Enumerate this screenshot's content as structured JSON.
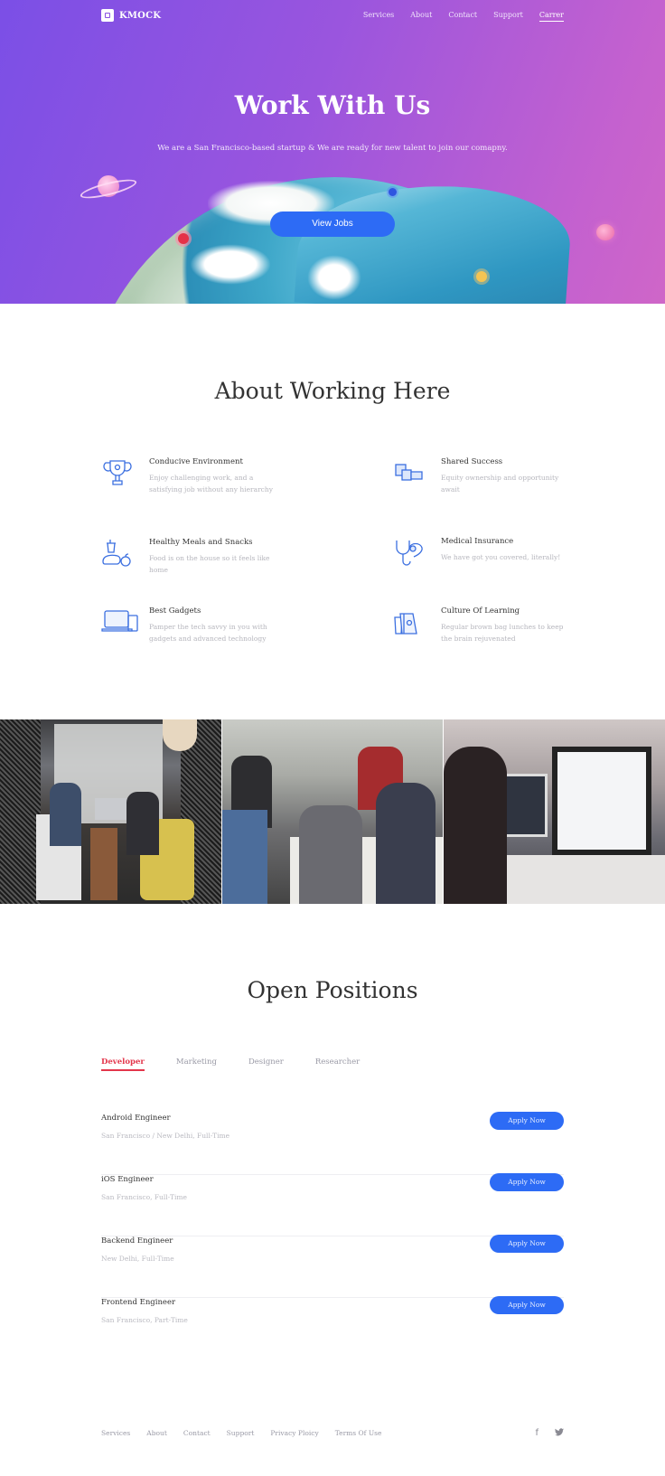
{
  "nav": {
    "brand": "KMOCK",
    "links": [
      {
        "label": "Services"
      },
      {
        "label": "About"
      },
      {
        "label": "Contact"
      },
      {
        "label": "Support"
      },
      {
        "label": "Carrer",
        "active": true
      }
    ]
  },
  "hero": {
    "title": "Work With Us",
    "subtitle": "We are a San Francisco-based startup & We are ready for new talent to join our comapny.",
    "cta_label": "View Jobs"
  },
  "about": {
    "title": "About Working Here",
    "features": [
      {
        "icon": "trophy-icon",
        "title": "Conducive Environment",
        "desc": "Enjoy challenging work, and a satisfying job without any hierarchy"
      },
      {
        "icon": "blocks-icon",
        "title": "Shared Success",
        "desc": "Equity ownership and opportunity await"
      },
      {
        "icon": "meal-icon",
        "title": "Healthy Meals and Snacks",
        "desc": "Food is on the house so it feels like home"
      },
      {
        "icon": "stethoscope-icon",
        "title": "Medical Insurance",
        "desc": "We have got you covered, literally!"
      },
      {
        "icon": "devices-icon",
        "title": "Best Gadgets",
        "desc": "Pamper the tech savvy in you with gadgets and advanced technology"
      },
      {
        "icon": "lunch-bag-icon",
        "title": "Culture Of Learning",
        "desc": "Regular brown bag lunches to keep the brain rejuvenated"
      }
    ]
  },
  "positions": {
    "title": "Open Positions",
    "tabs": [
      {
        "label": "Developer",
        "active": true
      },
      {
        "label": "Marketing"
      },
      {
        "label": "Designer"
      },
      {
        "label": "Researcher"
      }
    ],
    "jobs": [
      {
        "title": "Android Engineer",
        "meta": "San Francisco / New Delhi, Full-Time",
        "apply_label": "Apply  Now"
      },
      {
        "title": "iOS Engineer",
        "meta": "San Francisco, Full-Time",
        "apply_label": "Apply  Now"
      },
      {
        "title": "Backend Engineer",
        "meta": "New Delhi, Full-Time",
        "apply_label": "Apply  Now"
      },
      {
        "title": "Frontend Engineer",
        "meta": "San Francisco, Part-Time",
        "apply_label": "Apply  Now"
      }
    ]
  },
  "footer": {
    "links": [
      {
        "label": "Services"
      },
      {
        "label": "About"
      },
      {
        "label": "Contact"
      },
      {
        "label": "Support"
      },
      {
        "label": "Privacy Ploicy"
      },
      {
        "label": "Terms Of Use"
      }
    ],
    "social": [
      {
        "icon": "facebook-icon",
        "glyph": "f"
      },
      {
        "icon": "twitter-icon",
        "glyph": "🐦"
      }
    ]
  },
  "colors": {
    "accent_blue": "#2d6bf5",
    "active_tab_red": "#e3364b",
    "hero_gradient_start": "#7b4fe6",
    "hero_gradient_end": "#cf66c8"
  }
}
